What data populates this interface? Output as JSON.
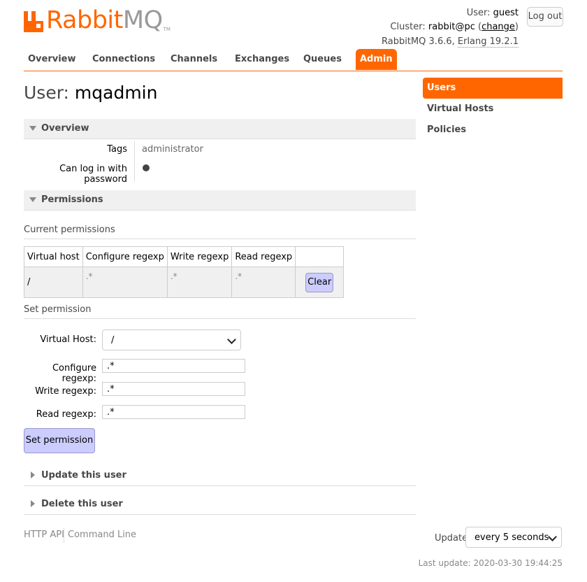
{
  "brand": {
    "rabbit": "Rabbit",
    "mq": "MQ",
    "tm": "TM"
  },
  "header": {
    "user_label": "User:",
    "user_value": "guest",
    "cluster_label": "Cluster:",
    "cluster_value": "rabbit@pc",
    "change_label": "change",
    "version": "RabbitMQ 3.6.6,",
    "erlang": "Erlang 19.2.1",
    "logout_label": "Log out"
  },
  "tabs": [
    {
      "label": "Overview"
    },
    {
      "label": "Connections"
    },
    {
      "label": "Channels"
    },
    {
      "label": "Exchanges"
    },
    {
      "label": "Queues"
    },
    {
      "label": "Admin"
    }
  ],
  "title": {
    "prefix": "User:",
    "name": "mqadmin"
  },
  "overview": {
    "section_label": "Overview",
    "tags_label": "Tags",
    "tags_value": "administrator",
    "password_label": "Can log in with password"
  },
  "permissions": {
    "section_label": "Permissions",
    "current_label": "Current permissions",
    "headers": [
      "Virtual host",
      "Configure regexp",
      "Write regexp",
      "Read regexp"
    ],
    "rows": [
      {
        "vhost": "/",
        "configure": ".*",
        "write": ".*",
        "read": ".*",
        "clear_label": "Clear"
      }
    ],
    "set_label": "Set permission",
    "form": {
      "vhost_label": "Virtual Host:",
      "vhost_value": "/",
      "configure_label": "Configure regexp:",
      "configure_value": ".*",
      "write_label": "Write regexp:",
      "write_value": ".*",
      "read_label": "Read regexp:",
      "read_value": ".*",
      "submit_label": "Set permission"
    }
  },
  "update_user": {
    "label": "Update this user"
  },
  "delete_user": {
    "label": "Delete this user"
  },
  "sidebar": {
    "items": [
      {
        "label": "Users"
      },
      {
        "label": "Virtual Hosts"
      },
      {
        "label": "Policies"
      }
    ]
  },
  "footer": {
    "http_api": "HTTP API",
    "command_line": "Command Line",
    "update_label": "Update",
    "update_value": "every 5 seconds",
    "last_update": "Last update: 2020-03-30 19:44:25"
  },
  "colors": {
    "accent": "#ff6600",
    "button": "#ccccff"
  }
}
